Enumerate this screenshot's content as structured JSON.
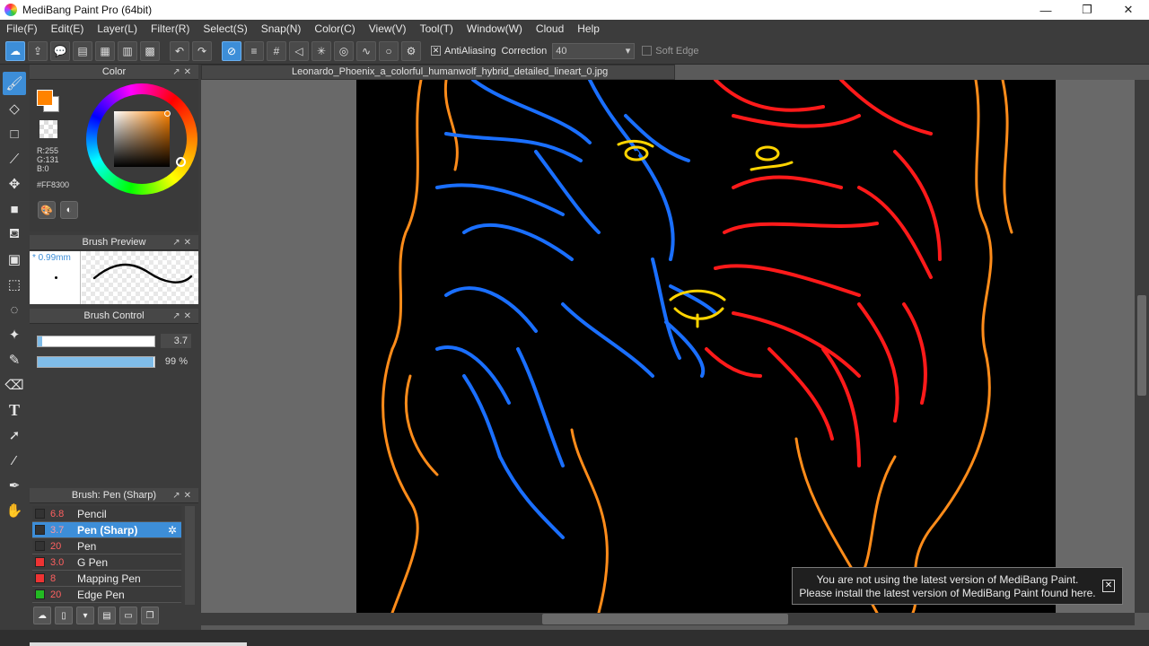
{
  "window": {
    "title": "MediBang Paint Pro (64bit)",
    "minimize": "—",
    "restore": "❐",
    "close": "✕"
  },
  "menu": [
    "File(F)",
    "Edit(E)",
    "Layer(L)",
    "Filter(R)",
    "Select(S)",
    "Snap(N)",
    "Color(C)",
    "View(V)",
    "Tool(T)",
    "Window(W)",
    "Cloud",
    "Help"
  ],
  "toolbar": {
    "antialiasing_label": "AntiAliasing",
    "antialiasing_checked": true,
    "correction_label": "Correction",
    "correction_value": "40",
    "soft_edge_label": "Soft Edge",
    "soft_edge_checked": false
  },
  "color_panel": {
    "title": "Color",
    "r": "R:255",
    "g": "G:131",
    "b": "B:0",
    "hex": "#FF8300",
    "foreground": "#FF8300"
  },
  "brush_preview": {
    "title": "Brush Preview",
    "size": "* 0.99mm"
  },
  "brush_control": {
    "title": "Brush Control",
    "size_value": "3.7",
    "opacity_value": "99 %",
    "size_fraction": 0.04,
    "opacity_fraction": 0.99
  },
  "brush_list": {
    "title": "Brush: Pen (Sharp)",
    "items": [
      {
        "size": "6.8",
        "name": "Pencil",
        "swatch": "#333333"
      },
      {
        "size": "3.7",
        "name": "Pen (Sharp)",
        "swatch": "#333333",
        "selected": true
      },
      {
        "size": "20",
        "name": "Pen",
        "swatch": "#333333"
      },
      {
        "size": "3.0",
        "name": "G Pen",
        "swatch": "#ee3333"
      },
      {
        "size": "8",
        "name": "Mapping Pen",
        "swatch": "#ee3333"
      },
      {
        "size": "20",
        "name": "Edge Pen",
        "swatch": "#22bb22"
      }
    ]
  },
  "document": {
    "tab_name": "Leonardo_Phoenix_a_colorful_humanwolf_hybrid_detailed_lineart_0.jpg"
  },
  "notification": {
    "line1": "You are not using the latest version of MediBang Paint.",
    "line2": "Please install the latest version of MediBang Paint found here.",
    "close": "✕"
  },
  "icons": {
    "tools": [
      "brush-icon",
      "eraser-icon",
      "shape-icon",
      "line-icon",
      "move-icon",
      "fill-rect-icon",
      "bucket-icon",
      "gradient-icon",
      "select-rect-icon",
      "lasso-icon",
      "magic-wand-icon",
      "select-pen-icon",
      "select-eraser-icon",
      "text-icon",
      "operation-icon",
      "eyedropper-icon",
      "dropper-icon",
      "hand-icon"
    ]
  }
}
